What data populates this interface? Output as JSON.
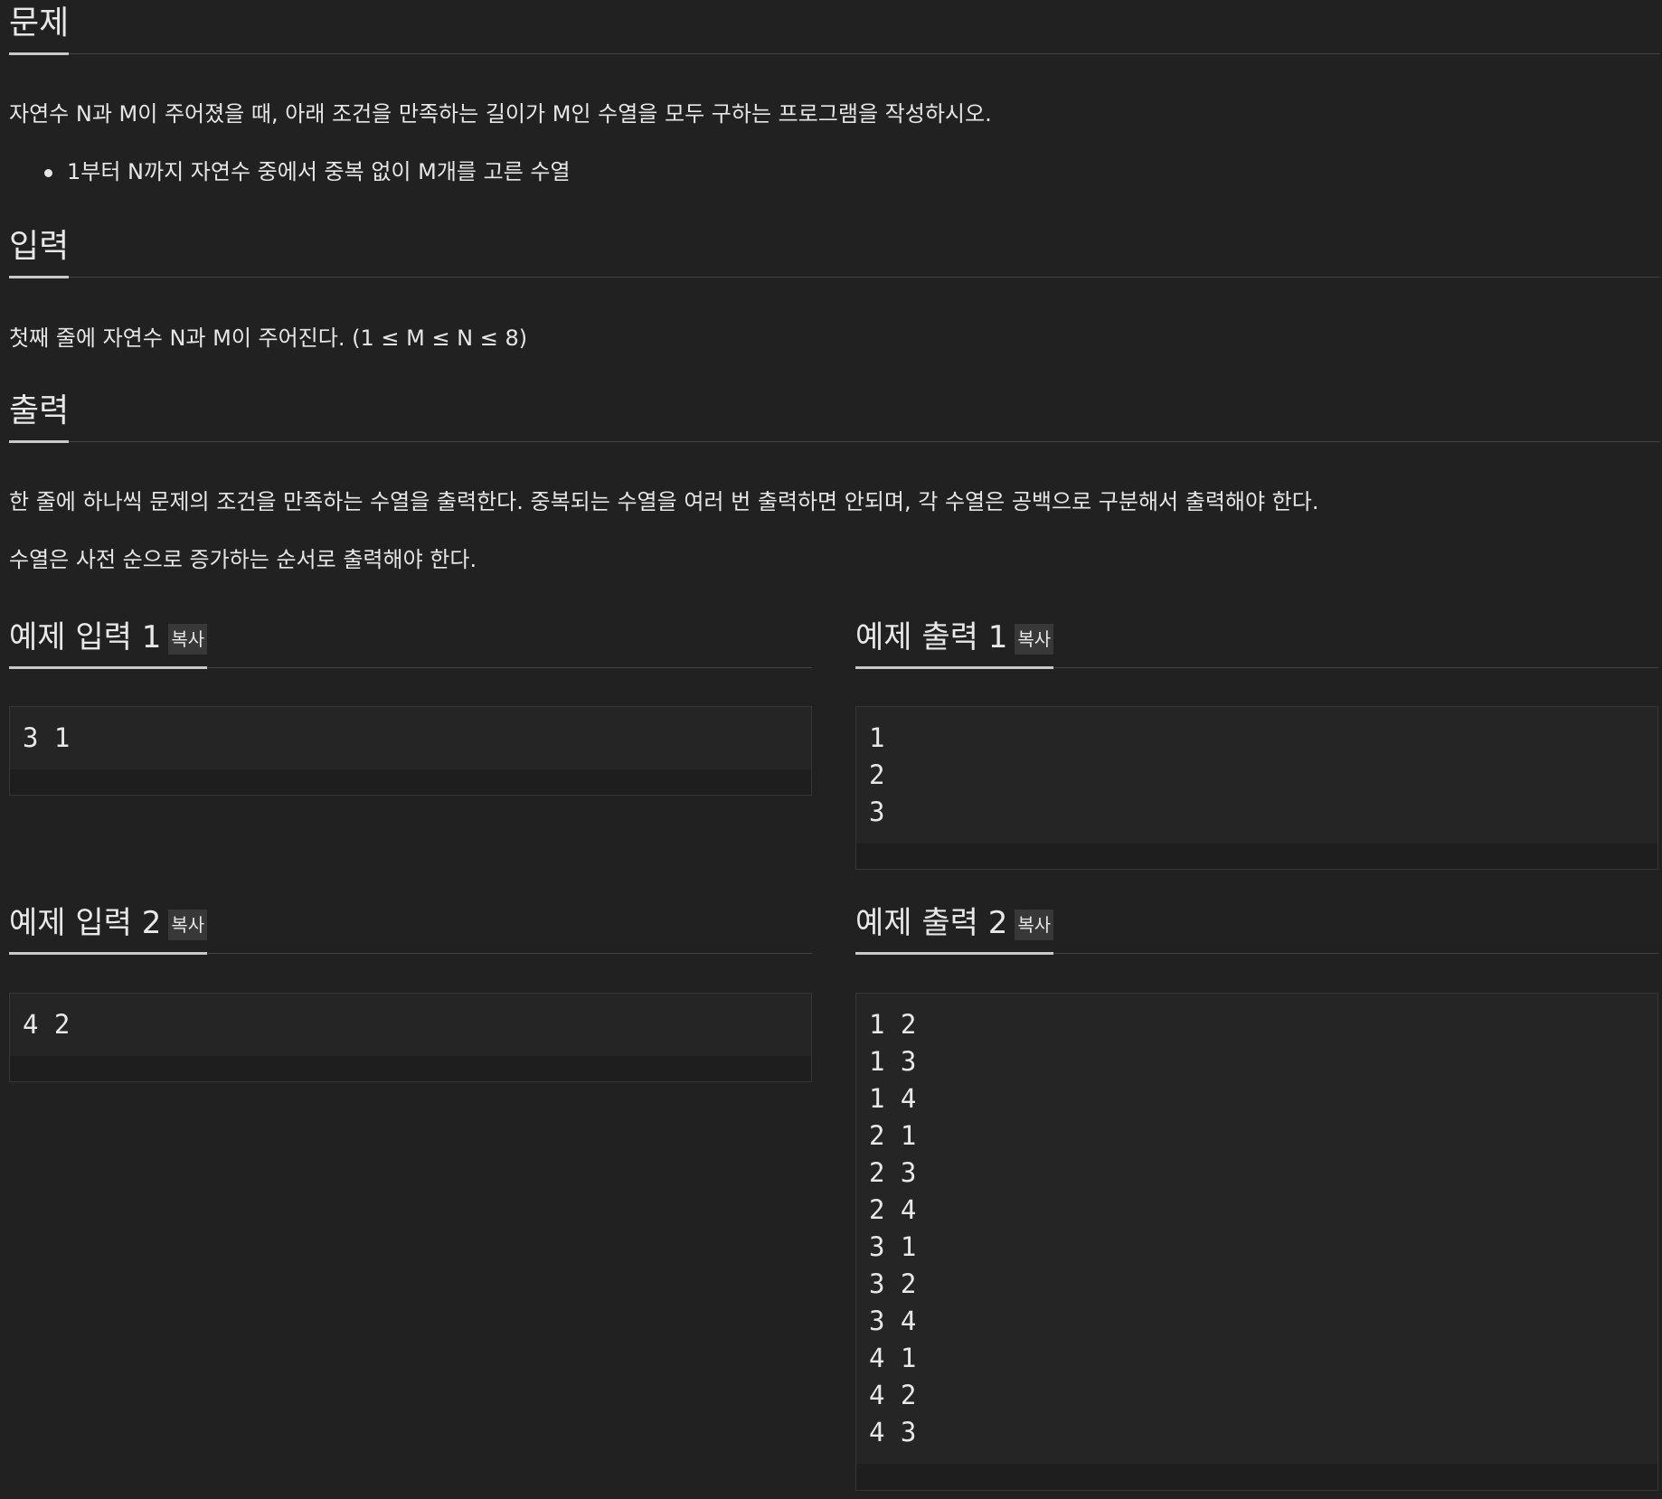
{
  "problem": {
    "heading": "문제",
    "description": "자연수 N과 M이 주어졌을 때, 아래 조건을 만족하는 길이가 M인 수열을 모두 구하는 프로그램을 작성하시오.",
    "conditions": [
      "1부터 N까지 자연수 중에서 중복 없이 M개를 고른 수열"
    ]
  },
  "input": {
    "heading": "입력",
    "description": "첫째 줄에 자연수 N과 M이 주어진다. (1 ≤ M ≤ N ≤ 8)"
  },
  "output": {
    "heading": "출력",
    "paragraphs": [
      "한 줄에 하나씩 문제의 조건을 만족하는 수열을 출력한다. 중복되는 수열을 여러 번 출력하면 안되며, 각 수열은 공백으로 구분해서 출력해야 한다.",
      "수열은 사전 순으로 증가하는 순서로 출력해야 한다."
    ]
  },
  "copy_label": "복사",
  "samples": [
    {
      "input_title": "예제 입력 1",
      "input": "3 1",
      "output_title": "예제 출력 1",
      "output": "1\n2\n3"
    },
    {
      "input_title": "예제 입력 2",
      "input": "4 2",
      "output_title": "예제 출력 2",
      "output": "1 2\n1 3\n1 4\n2 1\n2 3\n2 4\n3 1\n3 2\n3 4\n4 1\n4 2\n4 3"
    }
  ]
}
